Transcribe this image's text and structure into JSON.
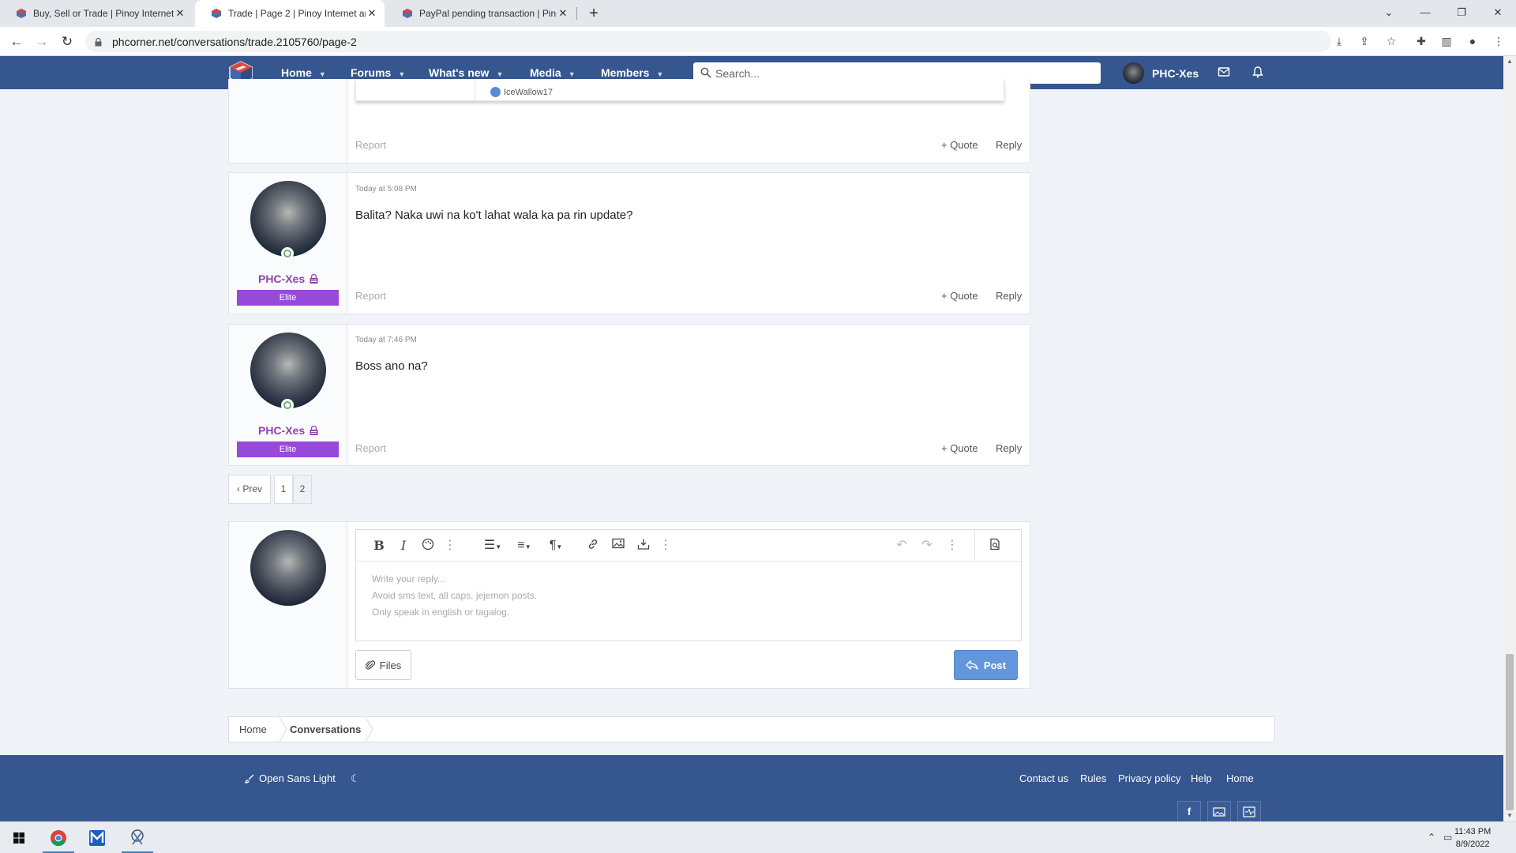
{
  "browser": {
    "tabs": [
      {
        "title": "Buy, Sell or Trade | Pinoy Internet",
        "active": false
      },
      {
        "title": "Trade | Page 2 | Pinoy Internet an",
        "active": true
      },
      {
        "title": "PayPal pending transaction | Pino",
        "active": false
      }
    ],
    "url": "phcorner.net/conversations/trade.2105760/page-2"
  },
  "header": {
    "nav": [
      {
        "label": "Home"
      },
      {
        "label": "Forums"
      },
      {
        "label": "What's new"
      },
      {
        "label": "Media"
      },
      {
        "label": "Members"
      }
    ],
    "search_placeholder": "Search...",
    "username": "PHC-Xes"
  },
  "messages": [
    {
      "quote_author": "IceWallow17",
      "report": "Report",
      "quote": "Quote",
      "reply": "Reply"
    },
    {
      "author": "PHC-Xes",
      "rank": "Elite",
      "time": "Today at 5:08 PM",
      "text": "Balita? Naka uwi na ko't lahat wala ka pa rin update?",
      "report": "Report",
      "quote": "Quote",
      "reply": "Reply"
    },
    {
      "author": "PHC-Xes",
      "rank": "Elite",
      "time": "Today at 7:46 PM",
      "text": "Boss ano na?",
      "report": "Report",
      "quote": "Quote",
      "reply": "Reply"
    }
  ],
  "pagination": {
    "prev": "Prev",
    "pages": [
      "1",
      "2"
    ],
    "current": "2"
  },
  "reply_box": {
    "placeholder_lines": [
      "Write your reply...",
      "Avoid sms text, all caps, jejemon posts.",
      "Only speak in english or tagalog."
    ],
    "files_label": "Files",
    "post_label": "Post"
  },
  "breadcrumb": [
    "Home",
    "Conversations"
  ],
  "footer": {
    "style_label": "Open Sans Light",
    "links": [
      "Contact us",
      "Rules",
      "Privacy policy",
      "Help",
      "Home"
    ]
  },
  "taskbar": {
    "time": "11:43 PM",
    "date": "8/9/2022"
  },
  "colors": {
    "header_bg": "#35568f",
    "username": "#8e44ad",
    "rank_badge": "#9749d9",
    "post_button": "#6396db"
  }
}
